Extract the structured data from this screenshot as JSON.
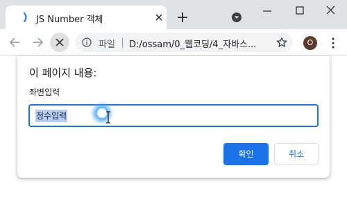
{
  "browser": {
    "tab": {
      "title": "JS Number 객체",
      "favicon": "loading-spinner-icon"
    },
    "profile_initial": "O",
    "omnibox": {
      "scheme_label": "파일",
      "url": "D:/ossam/0_웹코딩/4_자바스..."
    }
  },
  "dialog": {
    "title": "이 페이지 내용:",
    "message": "좌변입력",
    "input_value": "정수입력",
    "ok_label": "확인",
    "cancel_label": "취소"
  },
  "colors": {
    "accent": "#1a73e8",
    "tabstrip": "#dee1e6",
    "selection": "#b6cdf0"
  }
}
